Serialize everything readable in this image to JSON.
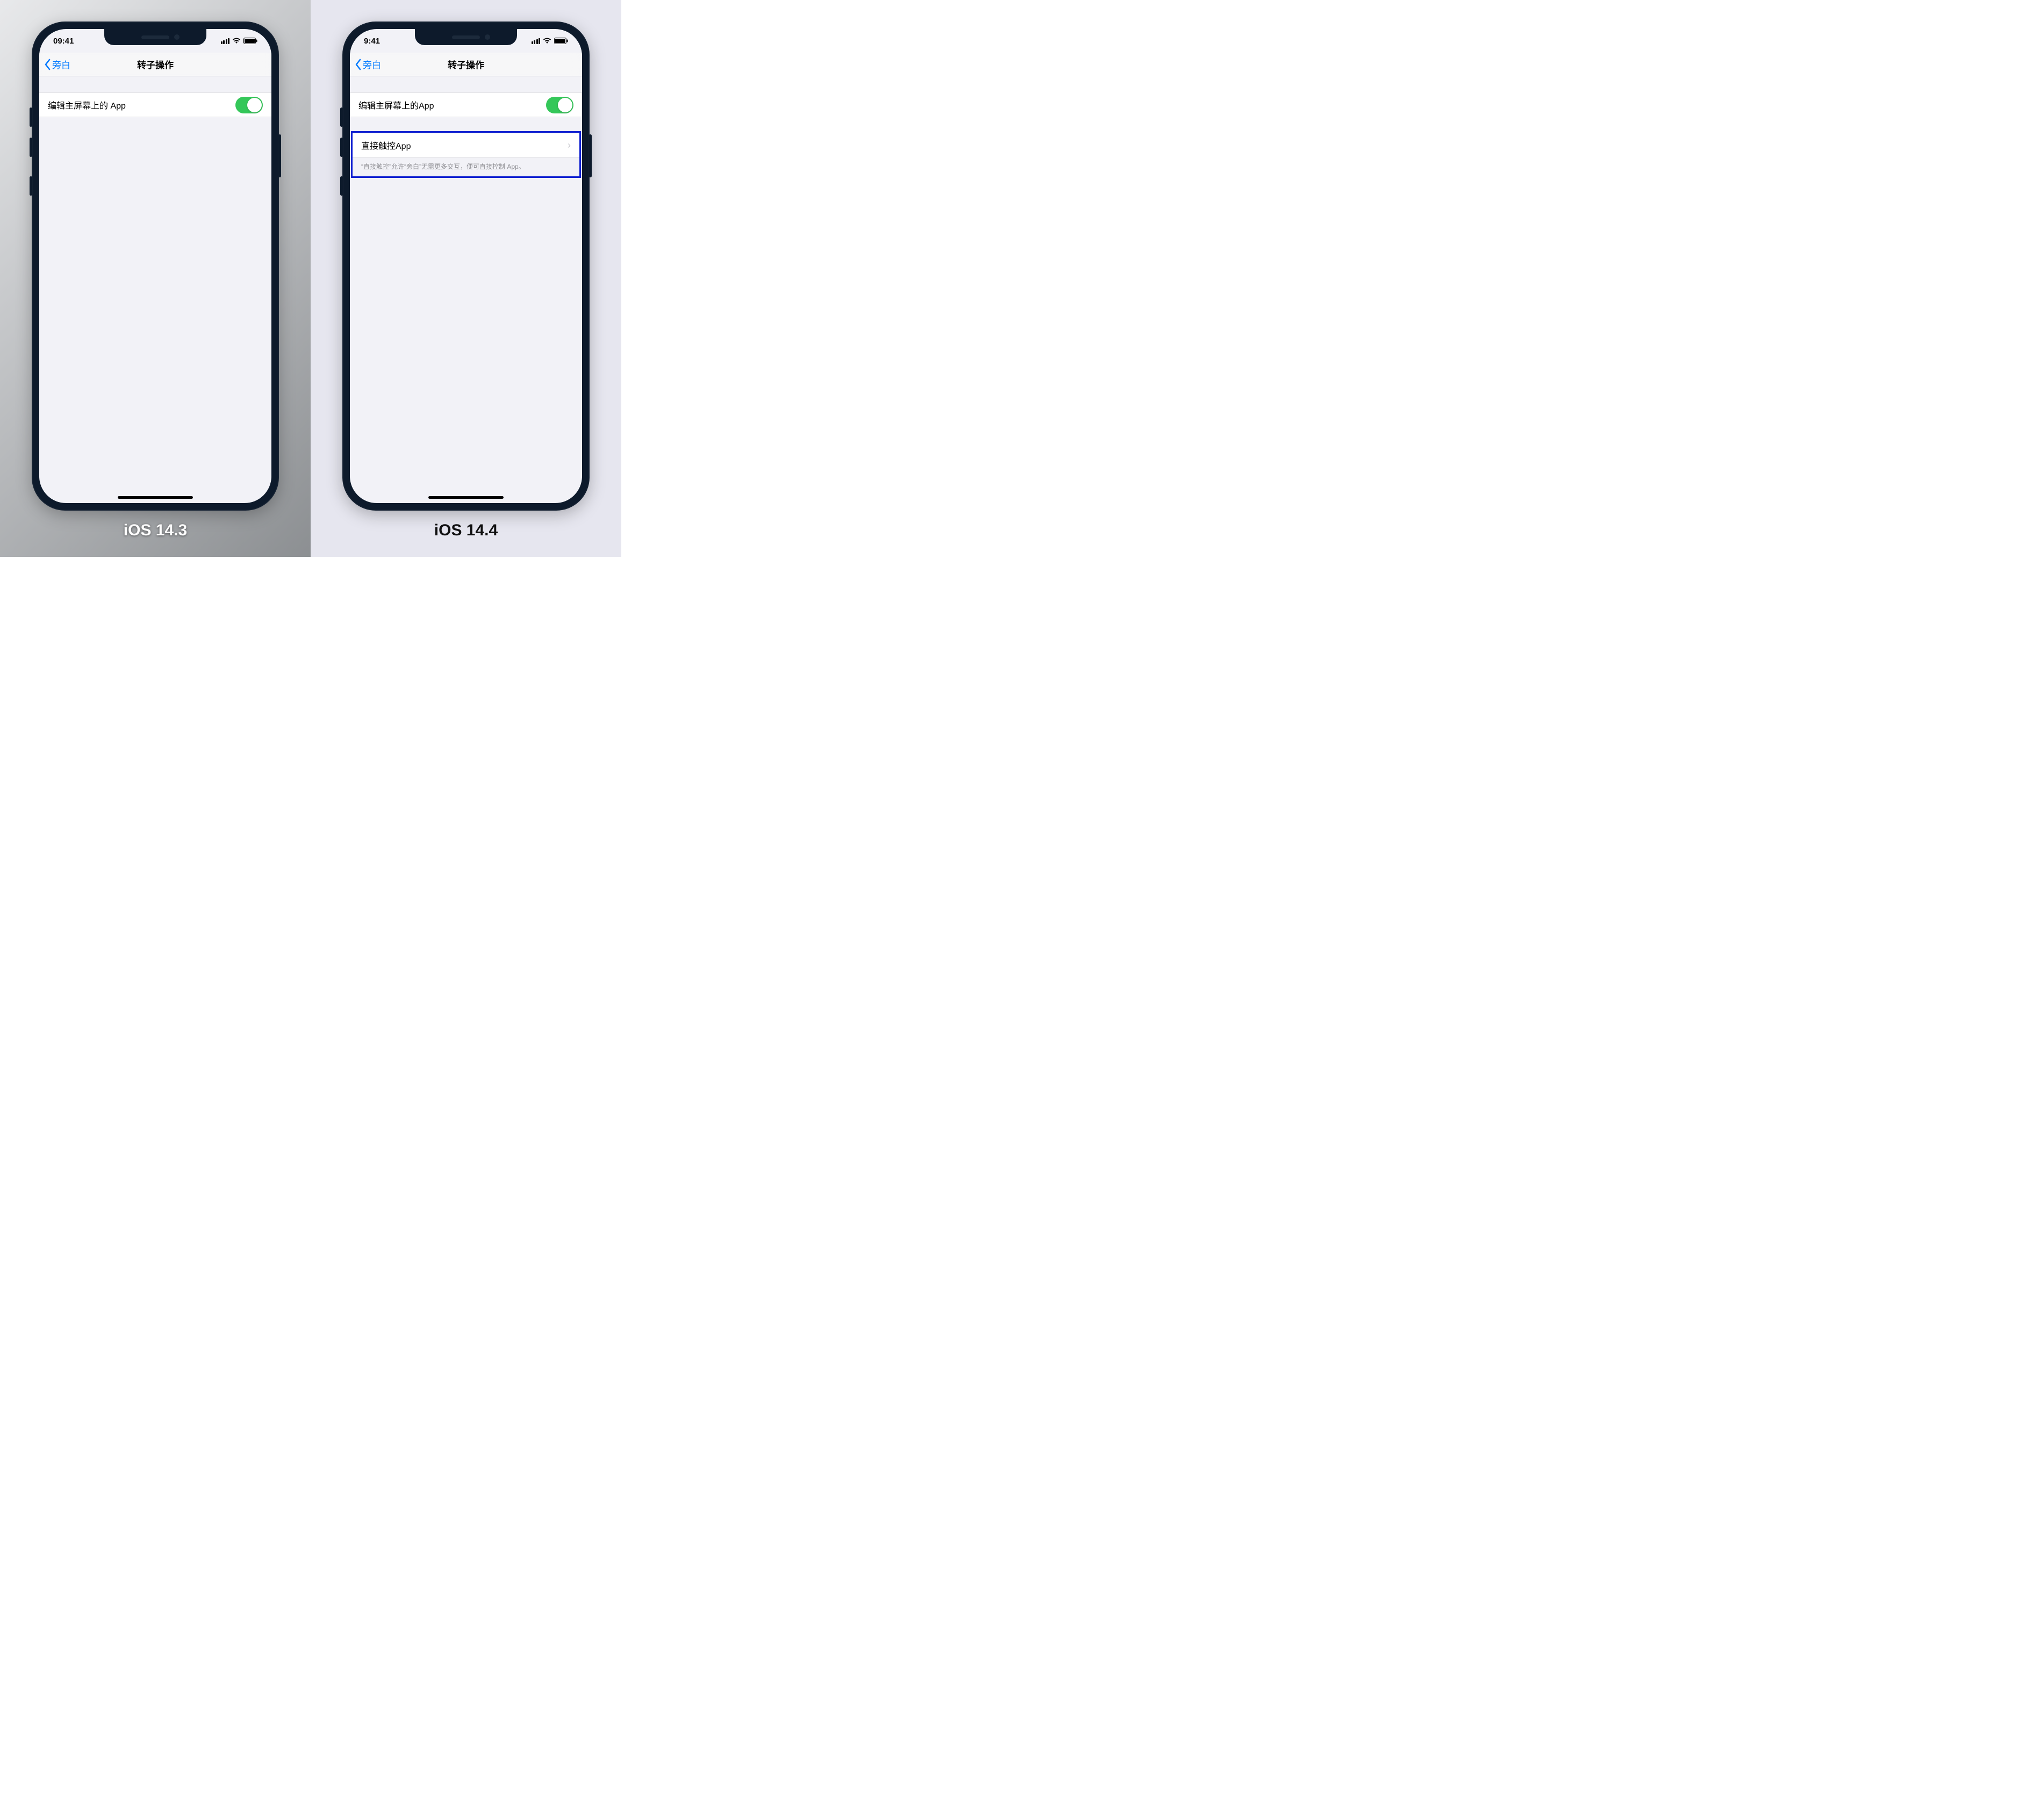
{
  "left": {
    "time": "09:41",
    "back_label": "旁白",
    "title": "转子操作",
    "row_edit_label": "编辑主屏幕上的 App",
    "caption": "iOS 14.3"
  },
  "right": {
    "time": "9:41",
    "back_label": "旁白",
    "title": "转子操作",
    "row_edit_label": "编辑主屏幕上的App",
    "row_direct_label": "直接触控App",
    "row_direct_footnote": "“直接触控”允许“旁白”无需更多交互，便可直接控制 App。",
    "caption": "iOS 14.4"
  },
  "colors": {
    "accent": "#007aff",
    "toggle_on": "#34c759",
    "highlight": "#1020d0"
  }
}
